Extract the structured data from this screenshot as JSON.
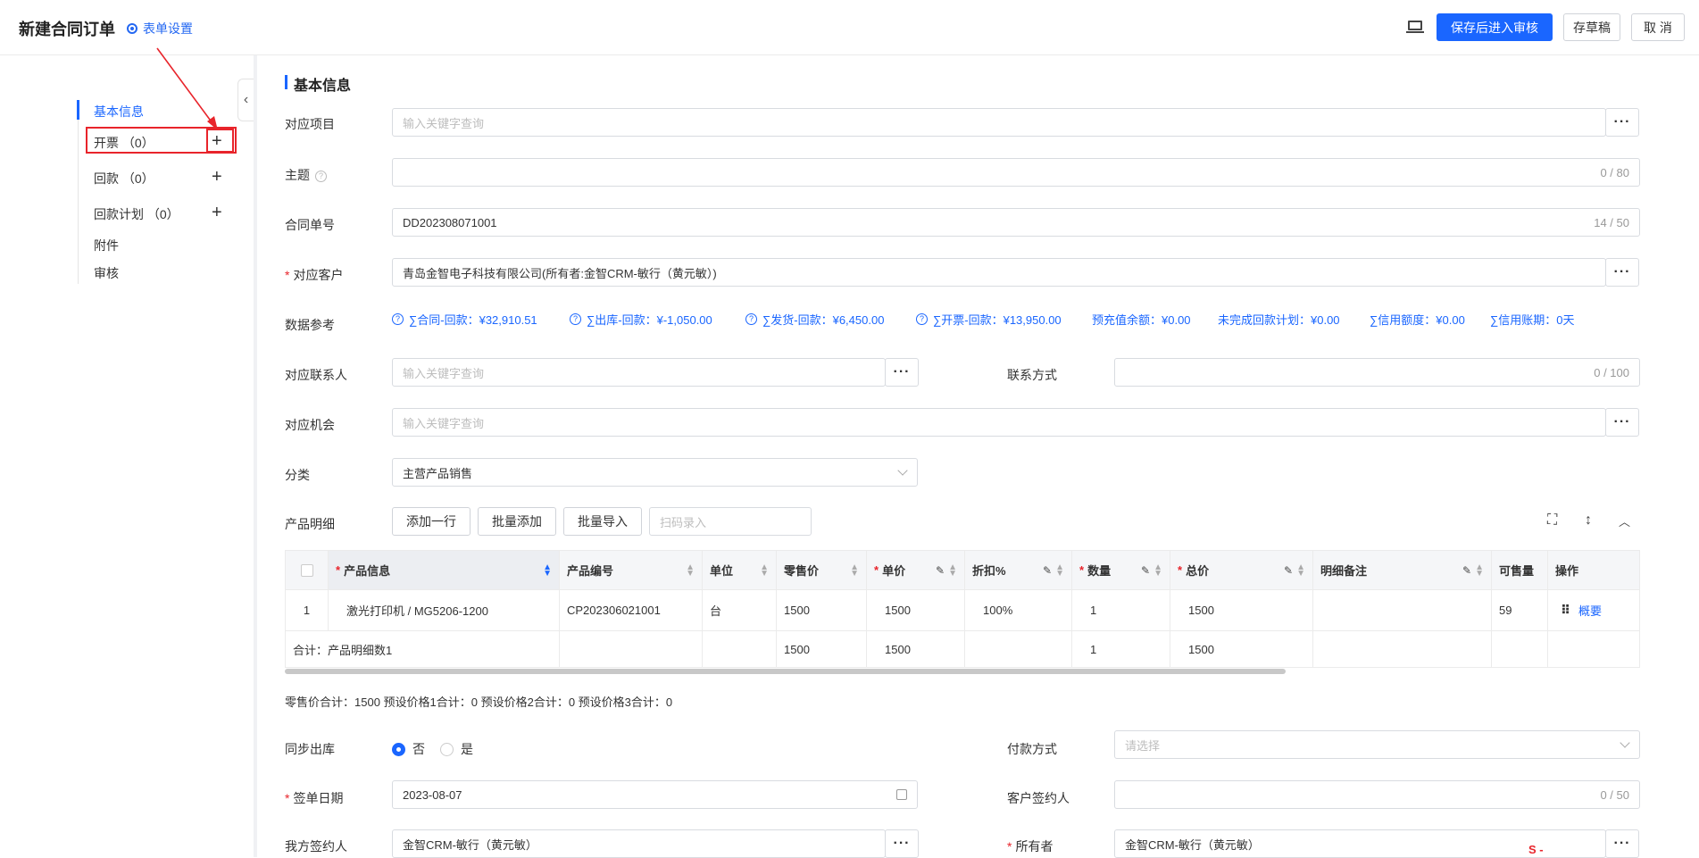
{
  "header": {
    "title": "新建合同订单",
    "form_settings": "表单设置",
    "save_review": "保存后进入审核",
    "save_draft": "存草稿",
    "cancel": "取 消"
  },
  "sidebar": {
    "items": [
      {
        "label": "基本信息"
      },
      {
        "label": "开票 （0）"
      },
      {
        "label": "回款 （0）"
      },
      {
        "label": "回款计划 （0）"
      },
      {
        "label": "附件"
      },
      {
        "label": "审核"
      }
    ],
    "plus": "+",
    "collapse": "‹"
  },
  "section": {
    "title": "基本信息"
  },
  "form": {
    "project": {
      "label": "对应项目",
      "placeholder": "输入关键字查询"
    },
    "subject": {
      "label": "主题",
      "count": "0 / 80"
    },
    "contract_no": {
      "label": "合同单号",
      "value": "DD202308071001",
      "count": "14 / 50"
    },
    "customer": {
      "label": "对应客户",
      "value": "青岛金智电子科技有限公司(所有者:金智CRM-敏行（黄元敏）)"
    },
    "data_ref": {
      "label": "数据参考",
      "items": [
        "∑合同-回款：¥32,910.51",
        "∑出库-回款：¥-1,050.00",
        "∑发货-回款：¥6,450.00",
        "∑开票-回款：¥13,950.00",
        "预充值余额：¥0.00",
        "未完成回款计划：¥0.00",
        "∑信用额度：¥0.00",
        "∑信用账期：0天"
      ]
    },
    "contact": {
      "label": "对应联系人",
      "placeholder": "输入关键字查询"
    },
    "contact_method": {
      "label": "联系方式",
      "count": "0 / 100"
    },
    "opportunity": {
      "label": "对应机会",
      "placeholder": "输入关键字查询"
    },
    "category": {
      "label": "分类",
      "value": "主营产品销售"
    },
    "products": {
      "label": "产品明细",
      "add_row": "添加一行",
      "batch_add": "批量添加",
      "batch_import": "批量导入",
      "scan_placeholder": "扫码录入"
    },
    "sync_out": {
      "label": "同步出库",
      "no": "否",
      "yes": "是"
    },
    "payment": {
      "label": "付款方式",
      "placeholder": "请选择"
    },
    "sign_date": {
      "label": "签单日期",
      "value": "2023-08-07"
    },
    "customer_signer": {
      "label": "客户签约人",
      "count": "0 / 50"
    },
    "our_signer": {
      "label": "我方签约人",
      "value": "金智CRM-敏行（黄元敏）"
    },
    "owner": {
      "label": "所有者",
      "value": "金智CRM-敏行（黄元敏）"
    }
  },
  "table": {
    "headers": [
      "产品信息",
      "产品编号",
      "单位",
      "零售价",
      "单价",
      "折扣%",
      "数量",
      "总价",
      "明细备注",
      "可售量",
      "操作"
    ],
    "row": {
      "index": "1",
      "product": "激光打印机 / MG5206-1200",
      "code": "CP202306021001",
      "unit": "台",
      "retail": "1500",
      "price": "1500",
      "discount": "100%",
      "qty": "1",
      "total": "1500",
      "note": "",
      "stock": "59",
      "action": "概要"
    },
    "summary": {
      "label": "合计：产品明细数1",
      "retail": "1500",
      "price": "1500",
      "qty": "1",
      "total": "1500"
    }
  },
  "totals_line": "零售价合计：1500 预设价格1合计：0 预设价格2合计：0 预设价格3合计：0",
  "colors": {
    "accent": "#1a66ff",
    "highlight": "#e8242b"
  }
}
